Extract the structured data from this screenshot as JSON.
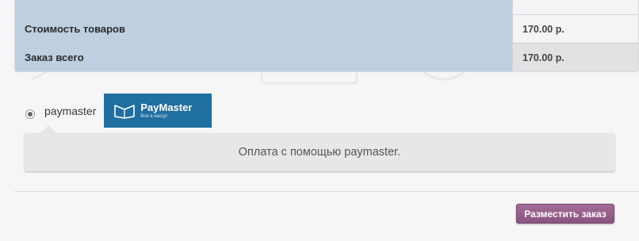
{
  "totals": {
    "rows": [
      {
        "label": "Стоимость товаров",
        "value": "170.00 р."
      },
      {
        "label": "Заказ всего",
        "value": "170.00 р."
      }
    ]
  },
  "payment": {
    "method_label": "paymaster",
    "selected": true,
    "logo": {
      "name": "PayMaster",
      "tagline": "Всё в кассу!"
    },
    "description": "Оплата с помощью paymaster."
  },
  "actions": {
    "place_order_label": "Разместить заказ"
  },
  "colors": {
    "totals_label_bg": "#bdcfe0",
    "logo_bg": "#1f6fa0",
    "place_order_bg": "#9a6190"
  }
}
